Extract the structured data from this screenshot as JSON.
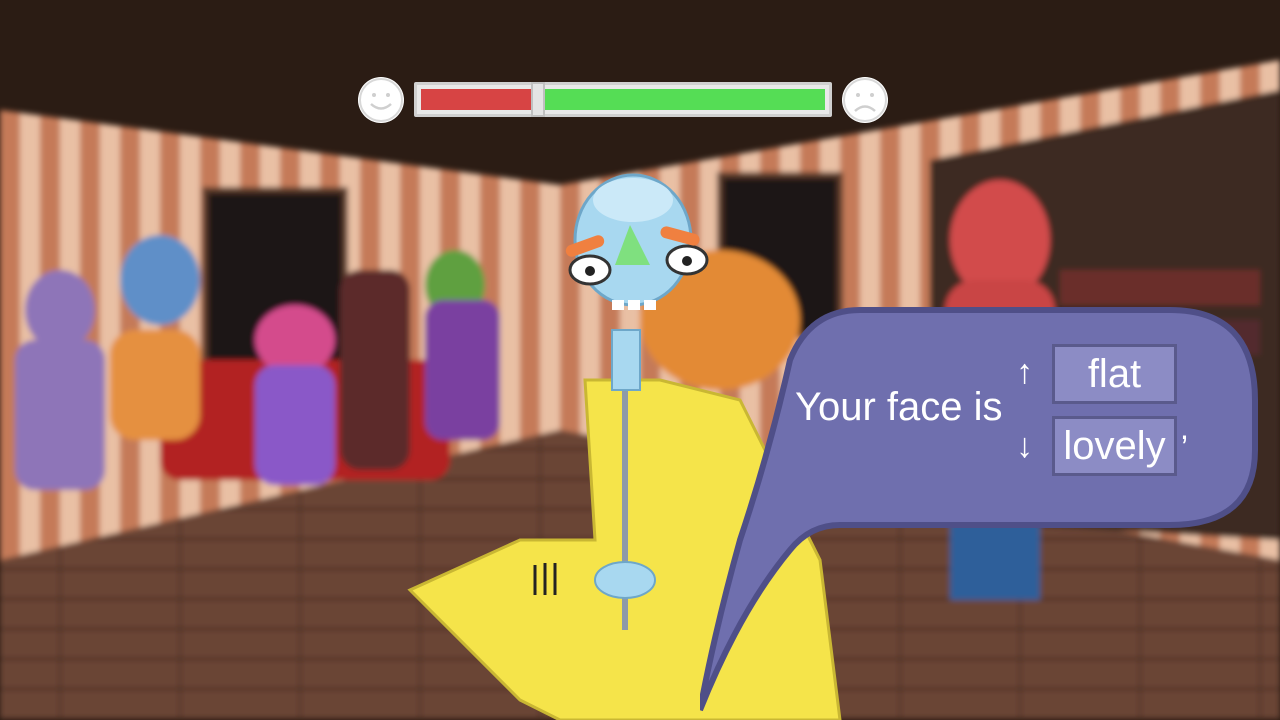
{
  "hud": {
    "happy_icon": "smiling-face-icon",
    "sad_icon": "frowning-face-icon",
    "mood_fraction": 0.29,
    "colors": {
      "negative": "#d74444",
      "positive": "#55dd55"
    }
  },
  "dialog": {
    "lead_text": "Your face is",
    "options": [
      {
        "key_icon": "up-arrow-icon",
        "key_glyph": "↑",
        "label": "flat"
      },
      {
        "key_icon": "down-arrow-icon",
        "key_glyph": "↓",
        "label": "lovely"
      }
    ],
    "trailing": ",",
    "bubble_color": "#6f6fae"
  }
}
